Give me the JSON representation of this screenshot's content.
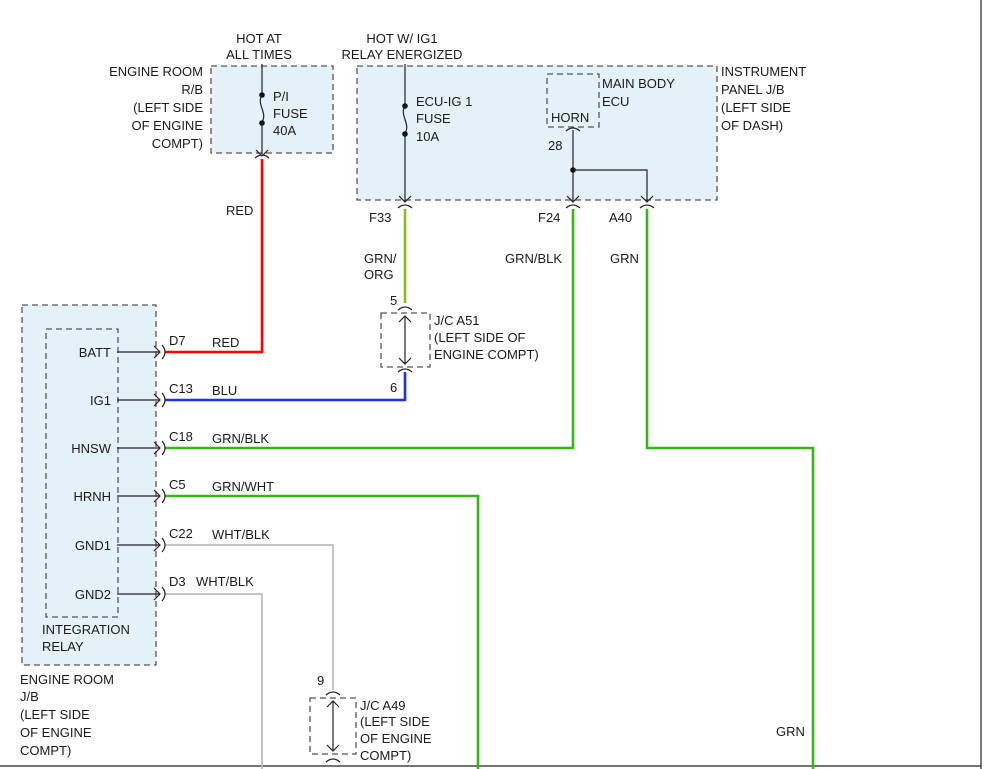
{
  "colors": {
    "box_fill": "#e4f1f8",
    "red": "#ff0000",
    "blue": "#1f2fe6",
    "green": "#39b21b",
    "green_orange": "#8bbb1c",
    "gray": "#bdbdbd"
  },
  "labels": {
    "hot_at_all_times_1": "HOT AT",
    "hot_at_all_times_2": "ALL TIMES",
    "hot_ig1_1": "HOT W/ IG1",
    "hot_ig1_2": "RELAY ENERGIZED",
    "engine_room_rb": [
      "ENGINE ROOM",
      "R/B",
      "(LEFT SIDE",
      "OF ENGINE",
      "COMPT)"
    ],
    "pi_fuse": [
      "P/I",
      "FUSE",
      "40A"
    ],
    "ecu_ig1_fuse": [
      "ECU-IG 1",
      "FUSE",
      "10A"
    ],
    "main_body_ecu": [
      "MAIN BODY",
      "ECU"
    ],
    "horn": "HORN",
    "pin_28": "28",
    "instrument_panel_jb": [
      "INSTRUMENT",
      "PANEL J/B",
      "(LEFT SIDE",
      "OF DASH)"
    ],
    "conn_f33": "F33",
    "conn_f24": "F24",
    "conn_a40": "A40",
    "wire_red_top": "RED",
    "wire_grn_org": [
      "GRN/",
      "ORG"
    ],
    "wire_grn_blk_top": "GRN/BLK",
    "wire_grn_top": "GRN",
    "jc_a51_pin_top": "5",
    "jc_a51_pin_bottom": "6",
    "jc_a51": [
      "J/C A51",
      "(LEFT SIDE OF",
      "ENGINE COMPT)"
    ],
    "relay_pins": [
      {
        "pin": "BATT",
        "conn": "D7",
        "wire": "RED"
      },
      {
        "pin": "IG1",
        "conn": "C13",
        "wire": "BLU"
      },
      {
        "pin": "HNSW",
        "conn": "C18",
        "wire": "GRN/BLK"
      },
      {
        "pin": "HRNH",
        "conn": "C5",
        "wire": "GRN/WHT"
      },
      {
        "pin": "GND1",
        "conn": "C22",
        "wire": "WHT/BLK"
      },
      {
        "pin": "GND2",
        "conn": "D3",
        "wire": "WHT/BLK"
      }
    ],
    "integration_relay": [
      "INTEGRATION",
      "RELAY"
    ],
    "engine_room_jb": [
      "ENGINE ROOM",
      "J/B",
      "(LEFT SIDE",
      "OF ENGINE",
      "COMPT)"
    ],
    "jc_a49_pin": "9",
    "jc_a49": [
      "J/C A49",
      "(LEFT SIDE",
      "OF ENGINE",
      "COMPT)"
    ],
    "wire_grn_bottom": "GRN"
  }
}
